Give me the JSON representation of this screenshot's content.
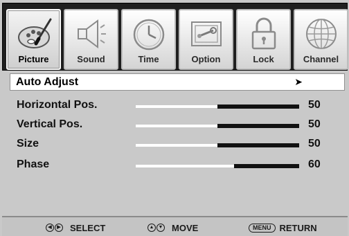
{
  "tabs": [
    {
      "label": "Picture",
      "icon": "picture-palette-icon",
      "active": true
    },
    {
      "label": "Sound",
      "icon": "speaker-icon",
      "active": false
    },
    {
      "label": "Time",
      "icon": "clock-icon",
      "active": false
    },
    {
      "label": "Option",
      "icon": "option-tools-icon",
      "active": false
    },
    {
      "label": "Lock",
      "icon": "padlock-icon",
      "active": false
    },
    {
      "label": "Channel",
      "icon": "globe-icon",
      "active": false
    }
  ],
  "menu": {
    "items": [
      {
        "label": "Auto Adjust",
        "selected": true,
        "arrow": "➤"
      },
      {
        "label": "Horizontal Pos.",
        "value": "50",
        "level": 0.5
      },
      {
        "label": "Vertical Pos.",
        "value": "50",
        "level": 0.5
      },
      {
        "label": "Size",
        "value": "50",
        "level": 0.5
      },
      {
        "label": "Phase",
        "value": "60",
        "level": 0.6
      }
    ]
  },
  "footer": {
    "select_label": "SELECT",
    "move_label": "MOVE",
    "menu_key": "MENU",
    "return_label": "RETURN"
  },
  "colors": {
    "background": "#c9c9c9",
    "tab_bar": "#1f1f1f",
    "highlight": "#ffffff",
    "slider_filled": "#111111"
  }
}
